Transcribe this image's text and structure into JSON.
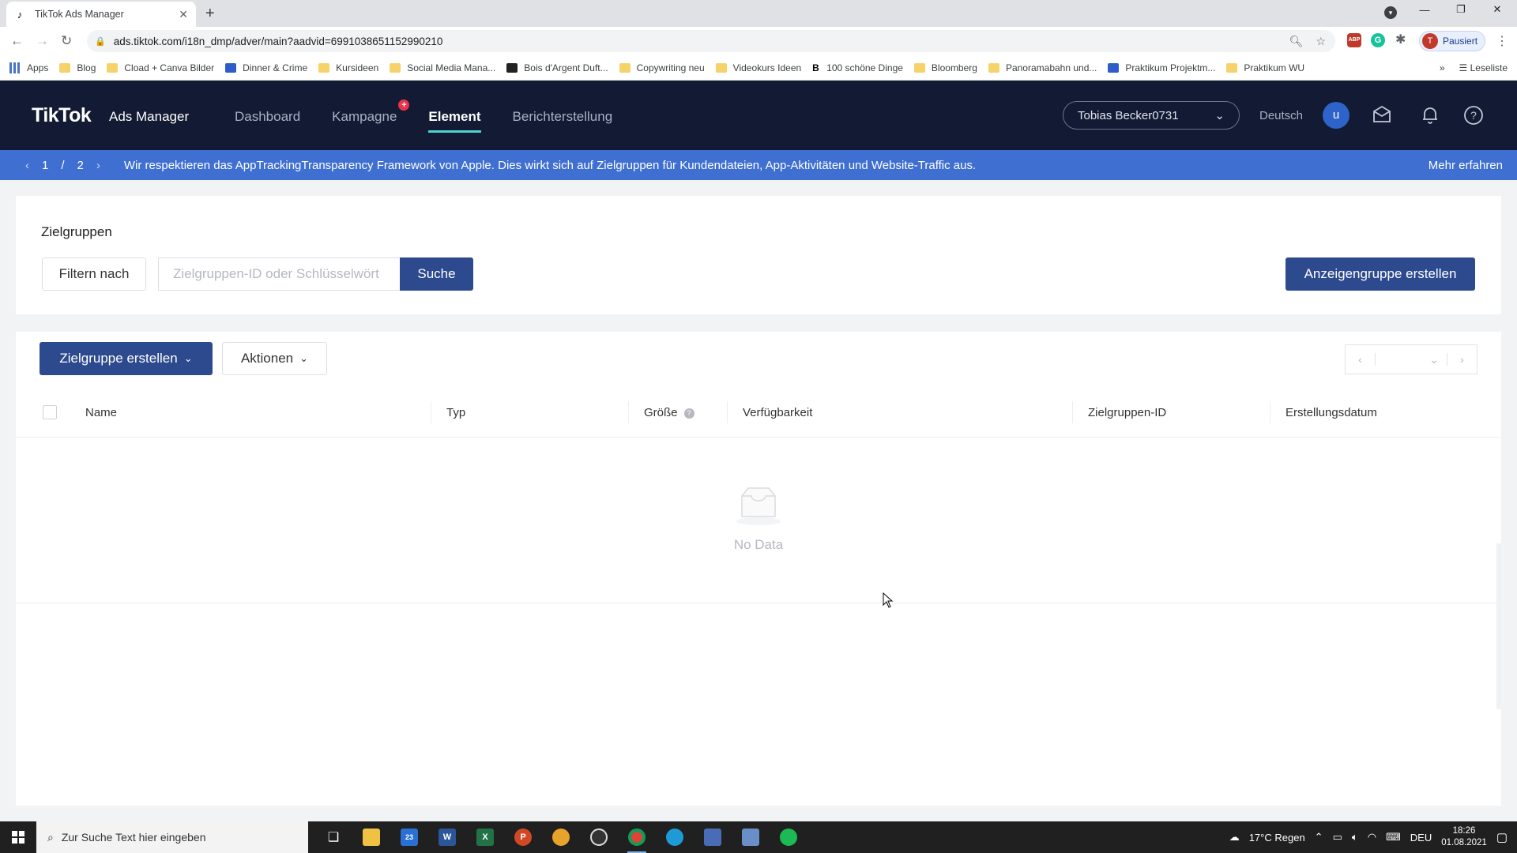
{
  "browser": {
    "tab_title": "TikTok Ads Manager",
    "url": "ads.tiktok.com/i18n_dmp/adver/main?aadvid=6991038651152990210",
    "profile_initial": "T",
    "profile_label": "Pausiert",
    "bookmarks": [
      {
        "label": "Apps",
        "icon": "apps"
      },
      {
        "label": "Blog",
        "icon": "folder"
      },
      {
        "label": "Cload + Canva Bilder",
        "icon": "folder"
      },
      {
        "label": "Dinner & Crime",
        "icon": "blue"
      },
      {
        "label": "Kursideen",
        "icon": "folder"
      },
      {
        "label": "Social Media Mana...",
        "icon": "folder"
      },
      {
        "label": "Bois d'Argent Duft...",
        "icon": "dark"
      },
      {
        "label": "Copywriting neu",
        "icon": "folder"
      },
      {
        "label": "Videokurs Ideen",
        "icon": "folder"
      },
      {
        "label": "100 schöne Dinge",
        "icon": "bold"
      },
      {
        "label": "Bloomberg",
        "icon": "folder"
      },
      {
        "label": "Panoramabahn und...",
        "icon": "folder"
      },
      {
        "label": "Praktikum Projektm...",
        "icon": "blue"
      },
      {
        "label": "Praktikum WU",
        "icon": "folder"
      }
    ],
    "reading_list": "Leseliste"
  },
  "header": {
    "logo": "TikTok",
    "logo_sub": "Ads Manager",
    "nav": [
      "Dashboard",
      "Kampagne",
      "Element",
      "Berichterstellung"
    ],
    "active_nav": "Element",
    "account": "Tobias Becker0731",
    "language": "Deutsch",
    "user_initial": "u"
  },
  "notice": {
    "page_current": "1",
    "page_sep": "/",
    "page_total": "2",
    "text": "Wir respektieren das AppTrackingTransparency Framework von Apple. Dies wirkt sich auf Zielgruppen für Kundendateien, App-Aktivitäten und Website-Traffic aus.",
    "more": "Mehr erfahren"
  },
  "audiences": {
    "title": "Zielgruppen",
    "filter_label": "Filtern nach",
    "search_placeholder": "Zielgruppen-ID oder Schlüsselwört",
    "search_button": "Suche",
    "create_adgroup": "Anzeigengruppe erstellen",
    "create_audience": "Zielgruppe erstellen",
    "actions": "Aktionen",
    "columns": [
      "Name",
      "Typ",
      "Größe",
      "Verfügbarkeit",
      "Zielgruppen-ID",
      "Erstellungsdatum"
    ],
    "empty_text": "No Data"
  },
  "taskbar": {
    "search_placeholder": "Zur Suche Text hier eingeben",
    "mail_badge": "23",
    "weather": "17°C  Regen",
    "lang": "DEU",
    "time": "18:26",
    "date": "01.08.2021"
  }
}
